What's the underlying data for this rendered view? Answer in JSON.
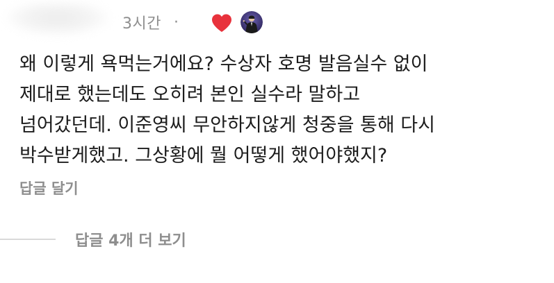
{
  "header": {
    "time_ago": "3시간",
    "separator": "·",
    "heart_icon": "heart-icon",
    "heart_color": "#e8323c"
  },
  "comment": {
    "lines": [
      "왜 이렇게 욕먹는거에요? 수상자 호명 발음실수 없이",
      "제대로 했는데도 오히려 본인 실수라 말하고",
      "넘어갔던데. 이준영씨 무안하지않게 청중을 통해 다시",
      "박수받게했고. 그상황에 뭘 어떻게 했어야했지?"
    ]
  },
  "actions": {
    "reply_label": "답글 달기",
    "view_more_replies_label": "답글 4개 더 보기"
  },
  "colors": {
    "text": "#1c1c1c",
    "muted": "#8e8e8e",
    "divider": "#d9d9d9",
    "avatar_bg": "#3a2d6b"
  }
}
